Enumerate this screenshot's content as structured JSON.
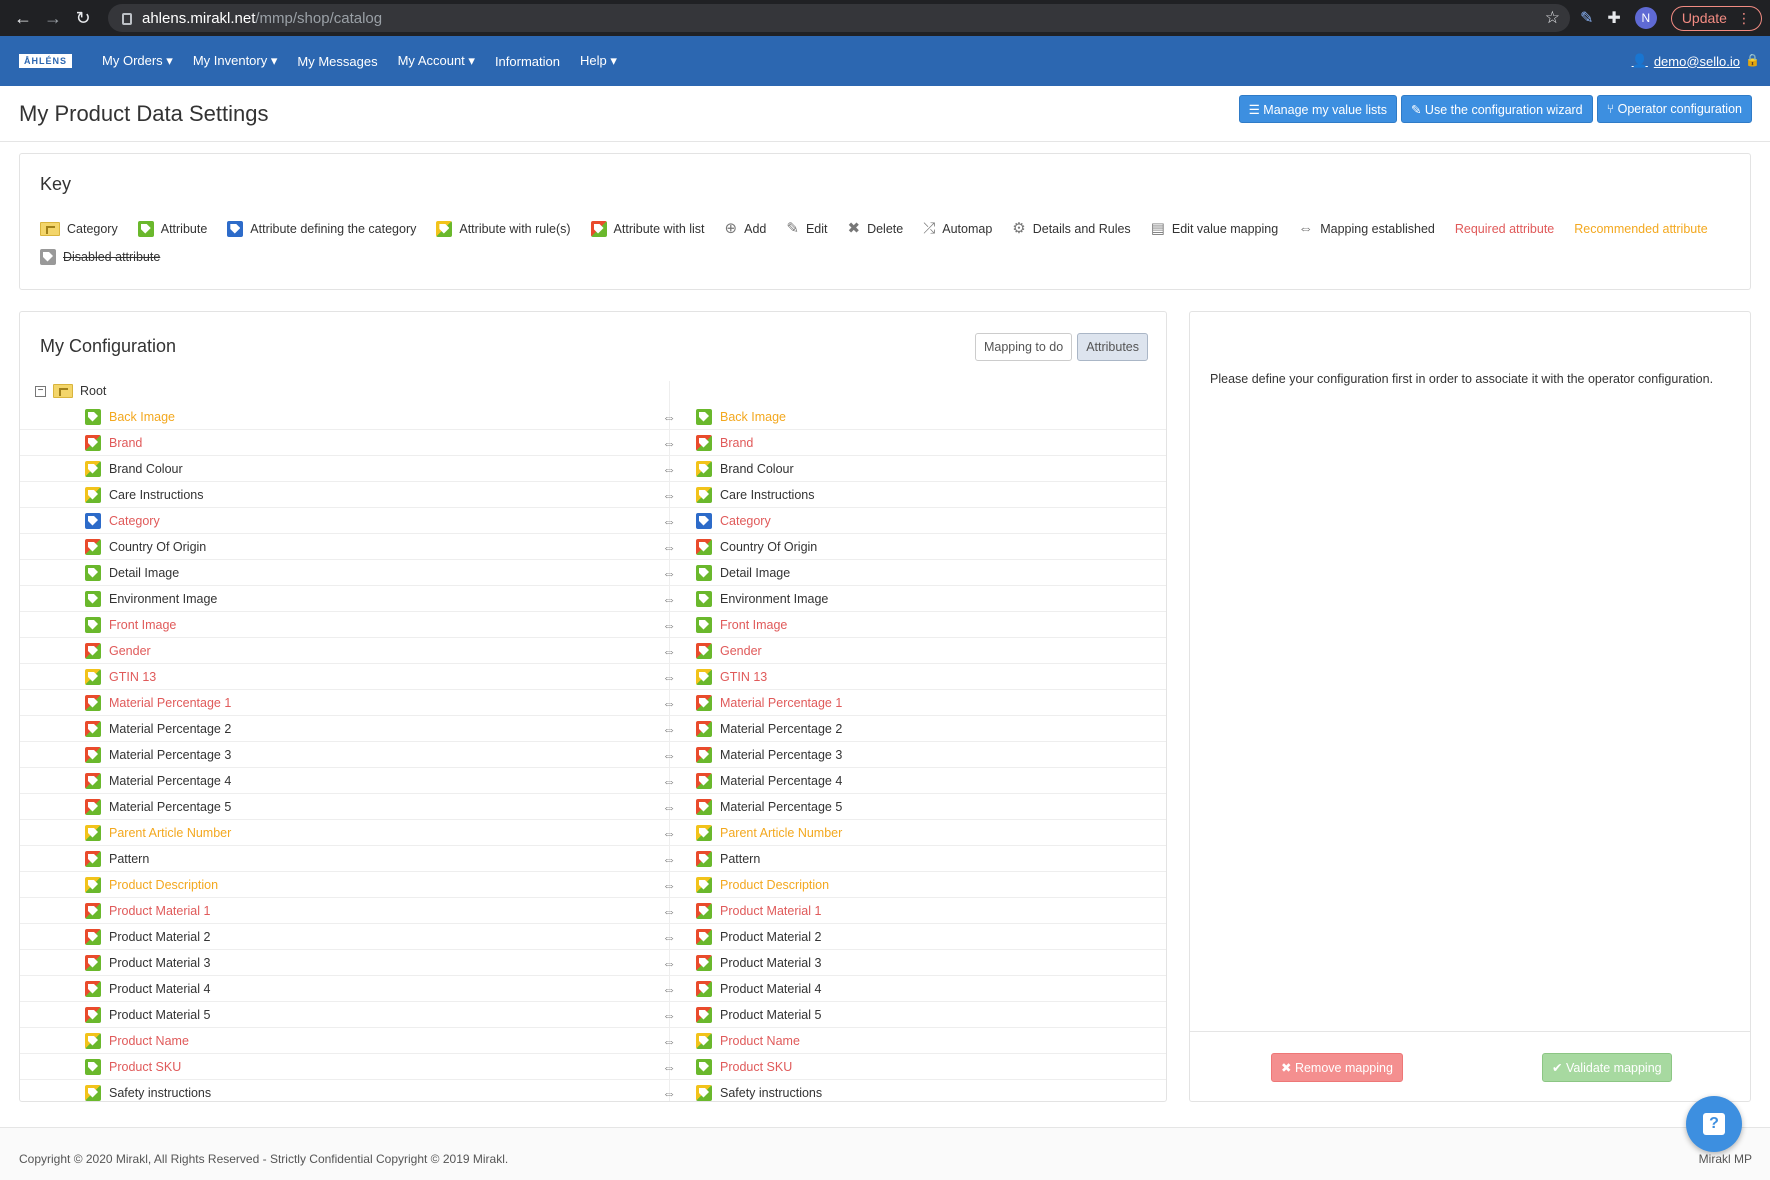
{
  "browser": {
    "url_host": "ahlens.mirakl.net",
    "url_path": "/mmp/shop/catalog",
    "avatar_letter": "N",
    "update_label": "Update"
  },
  "topnav": {
    "logo": "ÅHLÉNS",
    "menu": [
      "My Orders ▾",
      "My Inventory ▾",
      "My Messages",
      "My Account ▾",
      "Information",
      "Help ▾"
    ],
    "user": "demo@sello.io"
  },
  "page": {
    "title": "My Product Data Settings",
    "buttons": {
      "value_lists": "☰ Manage my value lists",
      "wizard": "✎ Use the configuration wizard",
      "operator": "⑂ Operator configuration"
    }
  },
  "key": {
    "title": "Key",
    "items": [
      {
        "icon": "category-icon",
        "label": "Category"
      },
      {
        "icon": "attribute-icon",
        "label": "Attribute"
      },
      {
        "icon": "attribute-defining-category-icon",
        "label": "Attribute defining the category"
      },
      {
        "icon": "attribute-rule-icon",
        "label": "Attribute with rule(s)"
      },
      {
        "icon": "attribute-list-icon",
        "label": "Attribute with list"
      },
      {
        "icon": "add-icon",
        "label": "Add"
      },
      {
        "icon": "edit-icon",
        "label": "Edit"
      },
      {
        "icon": "delete-icon",
        "label": "Delete"
      },
      {
        "icon": "automap-icon",
        "label": "Automap"
      },
      {
        "icon": "gear-icon",
        "label": "Details and Rules"
      },
      {
        "icon": "value-mapping-icon",
        "label": "Edit value mapping"
      },
      {
        "icon": "mapping-arrow-icon",
        "label": "Mapping established"
      },
      {
        "label": "Required attribute"
      },
      {
        "label": "Recommended attribute"
      },
      {
        "icon": "disabled-attribute-icon",
        "label": "Disabled attribute"
      }
    ]
  },
  "config": {
    "title": "My Configuration",
    "toggle": {
      "mapping_todo": "Mapping to do",
      "attributes": "Attributes"
    },
    "root_label": "Root",
    "rows": [
      {
        "left": "Back Image",
        "right": "Back Image",
        "status": "rec",
        "icon": "green"
      },
      {
        "left": "Brand",
        "right": "Brand",
        "status": "req",
        "icon": "list"
      },
      {
        "left": "Brand Colour",
        "right": "Brand Colour",
        "status": "nor",
        "icon": "rule"
      },
      {
        "left": "Care Instructions",
        "right": "Care Instructions",
        "status": "nor",
        "icon": "rule"
      },
      {
        "left": "Category",
        "right": "Category",
        "status": "req",
        "icon": "blue"
      },
      {
        "left": "Country Of Origin",
        "right": "Country Of Origin",
        "status": "nor",
        "icon": "list"
      },
      {
        "left": "Detail Image",
        "right": "Detail Image",
        "status": "nor",
        "icon": "green"
      },
      {
        "left": "Environment Image",
        "right": "Environment Image",
        "status": "nor",
        "icon": "green"
      },
      {
        "left": "Front Image",
        "right": "Front Image",
        "status": "req",
        "icon": "green"
      },
      {
        "left": "Gender",
        "right": "Gender",
        "status": "req",
        "icon": "list"
      },
      {
        "left": "GTIN 13",
        "right": "GTIN 13",
        "status": "req",
        "icon": "rule"
      },
      {
        "left": "Material Percentage 1",
        "right": "Material Percentage 1",
        "status": "req",
        "icon": "list"
      },
      {
        "left": "Material Percentage 2",
        "right": "Material Percentage 2",
        "status": "nor",
        "icon": "list"
      },
      {
        "left": "Material Percentage 3",
        "right": "Material Percentage 3",
        "status": "nor",
        "icon": "list"
      },
      {
        "left": "Material Percentage 4",
        "right": "Material Percentage 4",
        "status": "nor",
        "icon": "list"
      },
      {
        "left": "Material Percentage 5",
        "right": "Material Percentage 5",
        "status": "nor",
        "icon": "list"
      },
      {
        "left": "Parent Article Number",
        "right": "Parent Article Number",
        "status": "rec",
        "icon": "rule"
      },
      {
        "left": "Pattern",
        "right": "Pattern",
        "status": "nor",
        "icon": "list"
      },
      {
        "left": "Product Description",
        "right": "Product Description",
        "status": "rec",
        "icon": "rule"
      },
      {
        "left": "Product Material 1",
        "right": "Product Material 1",
        "status": "req",
        "icon": "list"
      },
      {
        "left": "Product Material 2",
        "right": "Product Material 2",
        "status": "nor",
        "icon": "list"
      },
      {
        "left": "Product Material 3",
        "right": "Product Material 3",
        "status": "nor",
        "icon": "list"
      },
      {
        "left": "Product Material 4",
        "right": "Product Material 4",
        "status": "nor",
        "icon": "list"
      },
      {
        "left": "Product Material 5",
        "right": "Product Material 5",
        "status": "nor",
        "icon": "list"
      },
      {
        "left": "Product Name",
        "right": "Product Name",
        "status": "req",
        "icon": "rule"
      },
      {
        "left": "Product SKU",
        "right": "Product SKU",
        "status": "req",
        "icon": "green"
      },
      {
        "left": "Safety instructions",
        "right": "Safety instructions",
        "status": "nor",
        "icon": "rule"
      }
    ]
  },
  "side": {
    "message": "Please define your configuration first in order to associate it with the operator configuration.",
    "remove_label": "✖ Remove mapping",
    "validate_label": "✔ Validate mapping"
  },
  "footer": {
    "copyright": "Copyright © 2020 Mirakl, All Rights Reserved - Strictly Confidential Copyright © 2019 Mirakl.",
    "brand": "Mirakl MP"
  }
}
